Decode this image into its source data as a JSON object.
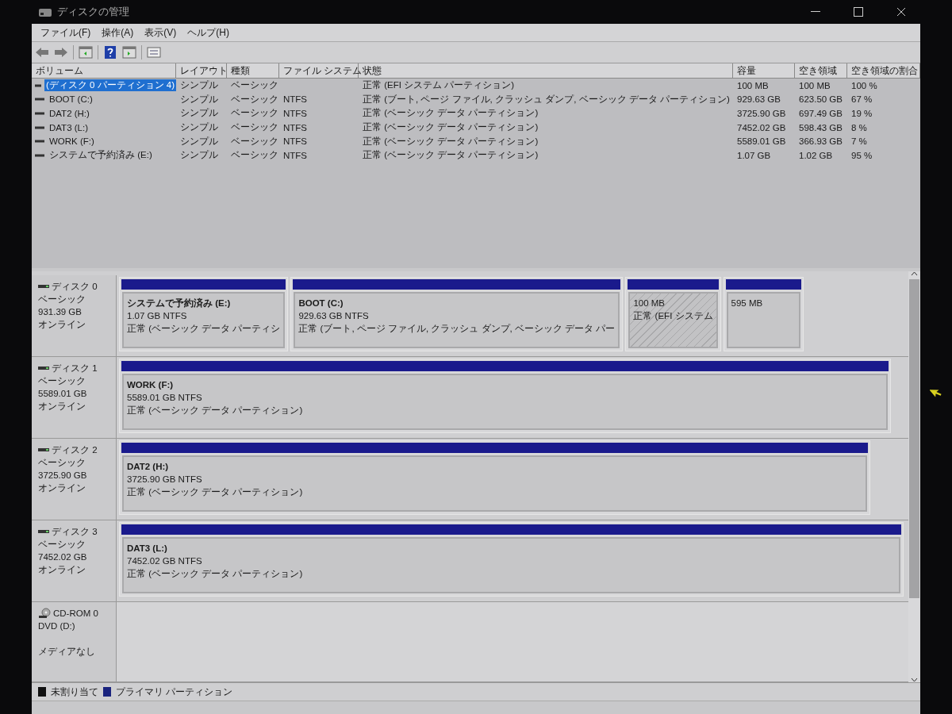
{
  "window": {
    "title": "ディスクの管理"
  },
  "menu": [
    "ファイル(F)",
    "操作(A)",
    "表示(V)",
    "ヘルプ(H)"
  ],
  "table": {
    "columns": [
      "ボリューム",
      "レイアウト",
      "種類",
      "ファイル システム",
      "状態",
      "容量",
      "空き領域",
      "空き領域の割合"
    ],
    "rows": [
      {
        "selected": true,
        "cells": [
          "(ディスク 0 パーティション 4)",
          "シンプル",
          "ベーシック",
          "",
          "正常 (EFI システム パーティション)",
          "100 MB",
          "100 MB",
          "100 %"
        ]
      },
      {
        "selected": false,
        "cells": [
          "BOOT (C:)",
          "シンプル",
          "ベーシック",
          "NTFS",
          "正常 (ブート, ページ ファイル, クラッシュ ダンプ, ベーシック データ パーティション)",
          "929.63 GB",
          "623.50 GB",
          "67 %"
        ]
      },
      {
        "selected": false,
        "cells": [
          "DAT2 (H:)",
          "シンプル",
          "ベーシック",
          "NTFS",
          "正常 (ベーシック データ パーティション)",
          "3725.90 GB",
          "697.49 GB",
          "19 %"
        ]
      },
      {
        "selected": false,
        "cells": [
          "DAT3 (L:)",
          "シンプル",
          "ベーシック",
          "NTFS",
          "正常 (ベーシック データ パーティション)",
          "7452.02 GB",
          "598.43 GB",
          "8 %"
        ]
      },
      {
        "selected": false,
        "cells": [
          "WORK (F:)",
          "シンプル",
          "ベーシック",
          "NTFS",
          "正常 (ベーシック データ パーティション)",
          "5589.01 GB",
          "366.93 GB",
          "7 %"
        ]
      },
      {
        "selected": false,
        "cells": [
          "システムで予約済み (E:)",
          "シンプル",
          "ベーシック",
          "NTFS",
          "正常 (ベーシック データ パーティション)",
          "1.07 GB",
          "1.02 GB",
          "95 %"
        ]
      }
    ]
  },
  "disks": [
    {
      "kind": "disk",
      "name": "ディスク 0",
      "type": "ベーシック",
      "size": "931.39 GB",
      "status": "オンライン",
      "partitions": [
        {
          "kind": "primary",
          "selected": false,
          "name": "システムで予約済み  (E:)",
          "info": "1.07 GB NTFS",
          "status": "正常 (ベーシック データ パーティシ"
        },
        {
          "kind": "primary",
          "selected": false,
          "name": "BOOT  (C:)",
          "info": "929.63 GB NTFS",
          "status": "正常 (ブート, ページ ファイル, クラッシュ ダンプ, ベーシック データ パー"
        },
        {
          "kind": "primary",
          "selected": true,
          "info": "100 MB",
          "status": "正常 (EFI システム"
        },
        {
          "kind": "primary",
          "selected": false,
          "info": "595 MB"
        }
      ]
    },
    {
      "kind": "disk",
      "name": "ディスク 1",
      "type": "ベーシック",
      "size": "5589.01 GB",
      "status": "オンライン",
      "partitions": [
        {
          "kind": "primary",
          "selected": false,
          "name": "WORK  (F:)",
          "info": "5589.01 GB NTFS",
          "status": "正常 (ベーシック データ パーティション)"
        }
      ]
    },
    {
      "kind": "disk",
      "name": "ディスク 2",
      "type": "ベーシック",
      "size": "3725.90 GB",
      "status": "オンライン",
      "partitions": [
        {
          "kind": "primary",
          "selected": false,
          "name": "DAT2  (H:)",
          "info": "3725.90 GB NTFS",
          "status": "正常 (ベーシック データ パーティション)"
        }
      ]
    },
    {
      "kind": "disk",
      "name": "ディスク 3",
      "type": "ベーシック",
      "size": "7452.02 GB",
      "status": "オンライン",
      "partitions": [
        {
          "kind": "primary",
          "selected": false,
          "name": "DAT3  (L:)",
          "info": "7452.02 GB NTFS",
          "status": "正常 (ベーシック データ パーティション)"
        }
      ]
    },
    {
      "kind": "cdrom",
      "name": "CD-ROM 0",
      "type": "DVD (D:)",
      "status": "メディアなし"
    }
  ],
  "legend": [
    {
      "label": "未割り当て",
      "color": "#111111"
    },
    {
      "label": "プライマリ パーティション",
      "color": "#1a237e"
    }
  ]
}
